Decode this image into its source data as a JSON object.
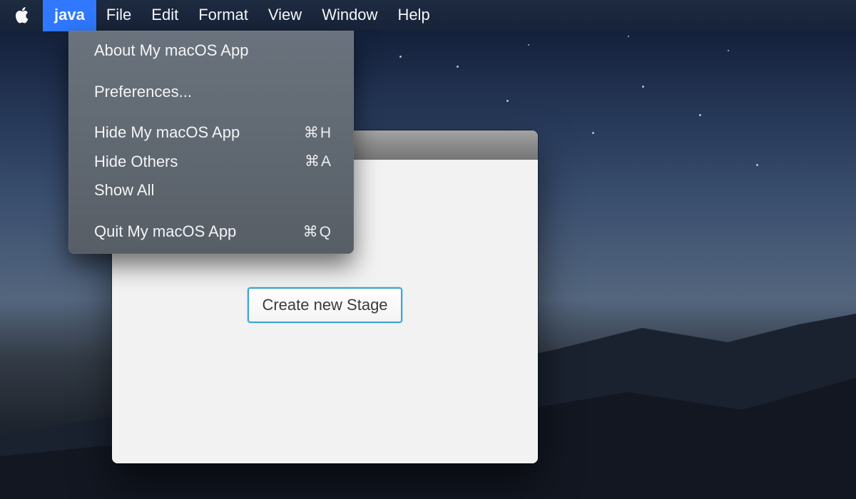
{
  "menubar": {
    "app_name": "java",
    "items": [
      "File",
      "Edit",
      "Format",
      "View",
      "Window",
      "Help"
    ]
  },
  "dropdown": {
    "about": {
      "label": "About My macOS App"
    },
    "preferences": {
      "label": "Preferences..."
    },
    "hide_app": {
      "label": "Hide My macOS App",
      "shortcut": "⌘H"
    },
    "hide_others": {
      "label": "Hide Others",
      "shortcut": "⌘A"
    },
    "show_all": {
      "label": "Show All"
    },
    "quit": {
      "label": "Quit My macOS App",
      "shortcut": "⌘Q"
    }
  },
  "window": {
    "create_button": "Create new Stage"
  }
}
